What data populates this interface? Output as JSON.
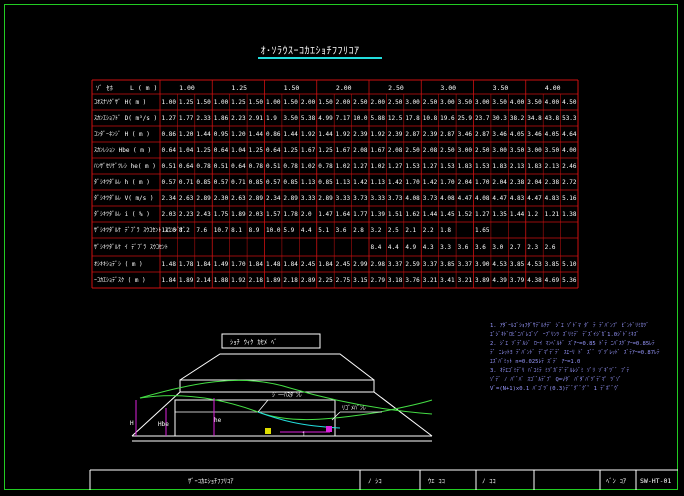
{
  "title": "ｵ･ｿﾗｳｽｰｺｶｴｼｮﾁﾌﾌﾘｺｱ",
  "table": {
    "header_left": [
      "ｿﾞ ｾﾎ",
      "L ( m )"
    ],
    "groups": [
      "1.00",
      "1.25",
      "1.50",
      "2.00",
      "2.50",
      "3.00",
      "3.50",
      "4.00"
    ],
    "rows": [
      {
        "label": "ｺｵｽﾅｿｸﾞｻﾞ   H( m )",
        "values": [
          "1.00",
          "1.25",
          "1.50",
          "1.00",
          "1.25",
          "1.50",
          "1.00",
          "1.50",
          "2.00",
          "1.50",
          "2.00",
          "2.50",
          "2.00",
          "2.50",
          "3.00",
          "2.50",
          "3.00",
          "3.50",
          "3.00",
          "3.50",
          "4.00",
          "3.50",
          "4.00",
          "4.50"
        ]
      },
      {
        "label": "ｽｶﾝｴｼｮﾌﾄﾞ  D( m³/s )",
        "values": [
          "1.27",
          "1.77",
          "2.33",
          "1.86",
          "2.23",
          "2.91",
          "1.9",
          "3.50",
          "5.38",
          "4.99",
          "7.17",
          "10.0",
          "5.88",
          "12.5",
          "17.8",
          "10.8",
          "19.6",
          "25.9",
          "23.7",
          "30.3",
          "38.2",
          "34.8",
          "43.8",
          "53.3"
        ]
      },
      {
        "label": "ｺﾝﾀﾞｰﾈﾝｼﾞ  H ( m )",
        "values": [
          "0.86",
          "1.20",
          "1.44",
          "0.95",
          "1.20",
          "1.44",
          "0.86",
          "1.44",
          "1.92",
          "1.44",
          "1.92",
          "2.39",
          "1.92",
          "2.39",
          "2.87",
          "2.39",
          "2.87",
          "3.46",
          "2.87",
          "3.46",
          "4.05",
          "3.46",
          "4.05",
          "4.64"
        ]
      },
      {
        "label": "ｽｶﾝﾚｼｮﾝ  Hbe ( m )",
        "values": [
          "0.64",
          "1.04",
          "1.25",
          "0.64",
          "1.04",
          "1.25",
          "0.64",
          "1.25",
          "1.67",
          "1.25",
          "1.67",
          "2.08",
          "1.67",
          "2.08",
          "2.50",
          "2.08",
          "2.50",
          "3.00",
          "2.50",
          "3.00",
          "3.50",
          "3.00",
          "3.50",
          "4.00"
        ]
      },
      {
        "label": "ﾊﾝｻﾞｾﾘｹﾞﾂﾚｼ  he( m )",
        "values": [
          "0.51",
          "0.64",
          "0.78",
          "0.51",
          "0.64",
          "0.78",
          "0.51",
          "0.78",
          "1.02",
          "0.78",
          "1.02",
          "1.27",
          "1.02",
          "1.27",
          "1.53",
          "1.27",
          "1.53",
          "1.83",
          "1.53",
          "1.83",
          "2.13",
          "1.83",
          "2.13",
          "2.46"
        ]
      },
      {
        "label": "ﾀﾞｼｷﾂﾀﾞﾙﾚ  h ( m )",
        "values": [
          "0.57",
          "0.71",
          "0.85",
          "0.57",
          "0.71",
          "0.85",
          "0.57",
          "0.85",
          "1.13",
          "0.85",
          "1.13",
          "1.42",
          "1.13",
          "1.42",
          "1.70",
          "1.42",
          "1.70",
          "2.04",
          "1.70",
          "2.04",
          "2.38",
          "2.04",
          "2.38",
          "2.72"
        ]
      },
      {
        "label": "ﾀﾞｼｷﾂﾀﾞﾙﾚ  V( m/s )",
        "values": [
          "2.34",
          "2.63",
          "2.89",
          "2.30",
          "2.63",
          "2.89",
          "2.34",
          "2.89",
          "3.33",
          "2.89",
          "3.33",
          "3.73",
          "3.33",
          "3.73",
          "4.08",
          "3.73",
          "4.08",
          "4.47",
          "4.08",
          "4.47",
          "4.83",
          "4.47",
          "4.83",
          "5.16"
        ]
      },
      {
        "label": "ﾀﾞｼｷﾂﾀﾞﾙﾚ  i ( % )",
        "values": [
          "2.03",
          "2.23",
          "2.43",
          "1.75",
          "1.89",
          "2.03",
          "1.57",
          "1.78",
          "2.0",
          "1.47",
          "1.64",
          "1.77",
          "1.39",
          "1.51",
          "1.62",
          "1.44",
          "1.45",
          "1.52",
          "1.27",
          "1.35",
          "1.44",
          "1.2",
          "1.21",
          "1.38"
        ]
      },
      {
        "label": "ｻﾞｼｷﾂﾀﾞﾙｹ ﾃﾞﾌﾞﾗ ｽｳｺｾﾝﾄ ｽﾗﾝｼﾞﾅﾞ",
        "values": [
          "11.0",
          "8.2",
          "7.6",
          "10.7",
          "8.1",
          "8.9",
          "10.0",
          "5.9",
          "4.4",
          "5.1",
          "3.6",
          "2.8",
          "3.2",
          "2.5",
          "2.1",
          "2.2",
          "1.8",
          "",
          "1.65",
          "",
          "",
          "",
          "",
          ""
        ]
      },
      {
        "label": "ｻﾞｼｷﾂﾀﾞﾙｹ ｲ ﾃﾞﾌﾞﾗ ｽｳｺｾﾝﾄ",
        "values": [
          "",
          "",
          "",
          "",
          "",
          "",
          "",
          "",
          "",
          "",
          "",
          "",
          "8.4",
          "4.4",
          "4.9",
          "4.3",
          "3.3",
          "3.6",
          "3.6",
          "3.0",
          "2.7",
          "2.3",
          "2.6",
          ""
        ]
      },
      {
        "label": "ｵｼｷｷｼｮﾃﾞｼ  ( m )",
        "values": [
          "1.48",
          "1.78",
          "1.84",
          "1.49",
          "1.70",
          "1.84",
          "1.48",
          "1.84",
          "2.45",
          "1.84",
          "2.45",
          "2.99",
          "2.98",
          "3.37",
          "2.59",
          "3.37",
          "3.85",
          "3.37",
          "3.90",
          "4.53",
          "3.85",
          "4.53",
          "3.85",
          "5.10"
        ]
      },
      {
        "label": "ｰｺｶｴｼｮﾃﾞｽｸ  ( m )",
        "values": [
          "1.84",
          "1.89",
          "2.14",
          "1.88",
          "1.92",
          "2.18",
          "1.89",
          "2.18",
          "2.89",
          "2.25",
          "2.75",
          "3.15",
          "2.79",
          "3.18",
          "3.76",
          "3.21",
          "3.41",
          "3.21",
          "3.89",
          "4.39",
          "3.79",
          "4.38",
          "4.69",
          "5.36"
        ]
      }
    ],
    "merged_label": "ｻﾞｼｷﾂｲ ｹﾞ ﾃﾞｽﾝ"
  },
  "diagram": {
    "label_top": "ｼｮﾁ ｳｨｸ ｶｾﾒ ﾍﾞ",
    "label_h": "H",
    "label_hbe": "Hbe",
    "label_he": "he",
    "label_i": "i",
    "label_callout1": "ｼﾞ一ﾊｽﾀﾞﾝﾚ",
    "label_callout2": "ﾘｺﾞﾒﾊﾞﾝﾚ"
  },
  "notes": [
    "1. ｱﾀﾞｰﾙｺﾞｼｮﾌﾀﾞｻﾃﾞﾙﾁﾃﾞ ｼﾞｴ ｿﾞﾄﾞﾏ ﾀﾞ ﾃ ﾃﾞﾊﾞﾝﾌﾟ ﾋﾞﾝﾄﾞﾘﾐｶﾂﾞ",
    "  ｴﾞｼﾞｷﾄﾞﾛﾋﾞﾆﾊﾞﾚｺﾞｿﾞ ｰﾌﾟﾘﾝﾂ ｽﾞﾘﾐﾃﾞ ﾃﾞｽﾞｲｼﾞｶﾞ1.0ｼﾞﾄﾞﾐｷｽﾞ",
    "2. ｼﾞｴ ｿﾞﾃﾞﾙｼﾞ ﾛｰｲ ﾏﾝﾍﾞﾙﾄﾞ ｽﾞｱｰ=0.85 ﾄﾞﾃ ﾆﾊﾞｽｹﾞｱｰ=0.85ﾚﾃ",
    "  ﾃﾞ ﾆﾚｯﾄﾖ ﾃﾞﾊﾞﾝﾄﾞ ﾃﾞﾏﾟﾃﾞﾃﾞ ｽｴｰﾘ ﾄﾞ ｽﾞﾞ ﾂﾞﾂﾞﾚｯﾄﾞ ｽﾞﾃｱｰ=0.87ﾚﾃ",
    "  ｴｽﾞﾊﾞﾐｯﾄ n=0.025ﾚﾃ ｽﾞﾃﾞ ｱｰ=1.0",
    "3. ｵﾃｴｺﾞﾐﾃﾞﾘ ﾊﾞｺﾐﾃ ﾐｿﾞｶﾞﾃﾞﾃﾞﾙﾚｼﾞﾐ ｿﾞﾘ ｿﾞｷﾞﾂﾞﾞ ﾌﾞﾃ",
    "  ｿﾞﾃﾞ ﾉ ﾊﾟﾞﾊﾞ ｽｺﾞﾞﾙﾃﾞﾌﾟ Q=√ﾀﾞ ﾊﾞﾀﾞﾊﾞﾂﾞﾃﾞﾏﾟ ﾂﾞｿﾞ",
    "  Vﾞ=(N+1)x0.1 ﾊﾞｺﾞﾂﾞ(0.3)ﾃﾞﾞｸﾞﾞｸﾞﾟ 1 ﾃﾞﾎﾟﾞｳﾞ"
  ],
  "footer": {
    "f1": "ｻﾞｰｺｶｴｼｮﾁﾌﾌﾘｺｱ",
    "f2": "ﾉ  ｼｺ",
    "f3": "ｳｴ ｺｺ",
    "f4": "ﾉ ｺｺ",
    "f5": "ﾍﾞﾝ ｺｱ",
    "f6": "SW-HT-01"
  },
  "colors": {
    "grid": "#cc1111",
    "frame": "#22cc22",
    "text": "#ffffff",
    "cyan": "#22dddd",
    "blue": "#6666ff",
    "yellow": "#dddd00",
    "green": "#44dd44",
    "magenta": "#dd22dd"
  }
}
